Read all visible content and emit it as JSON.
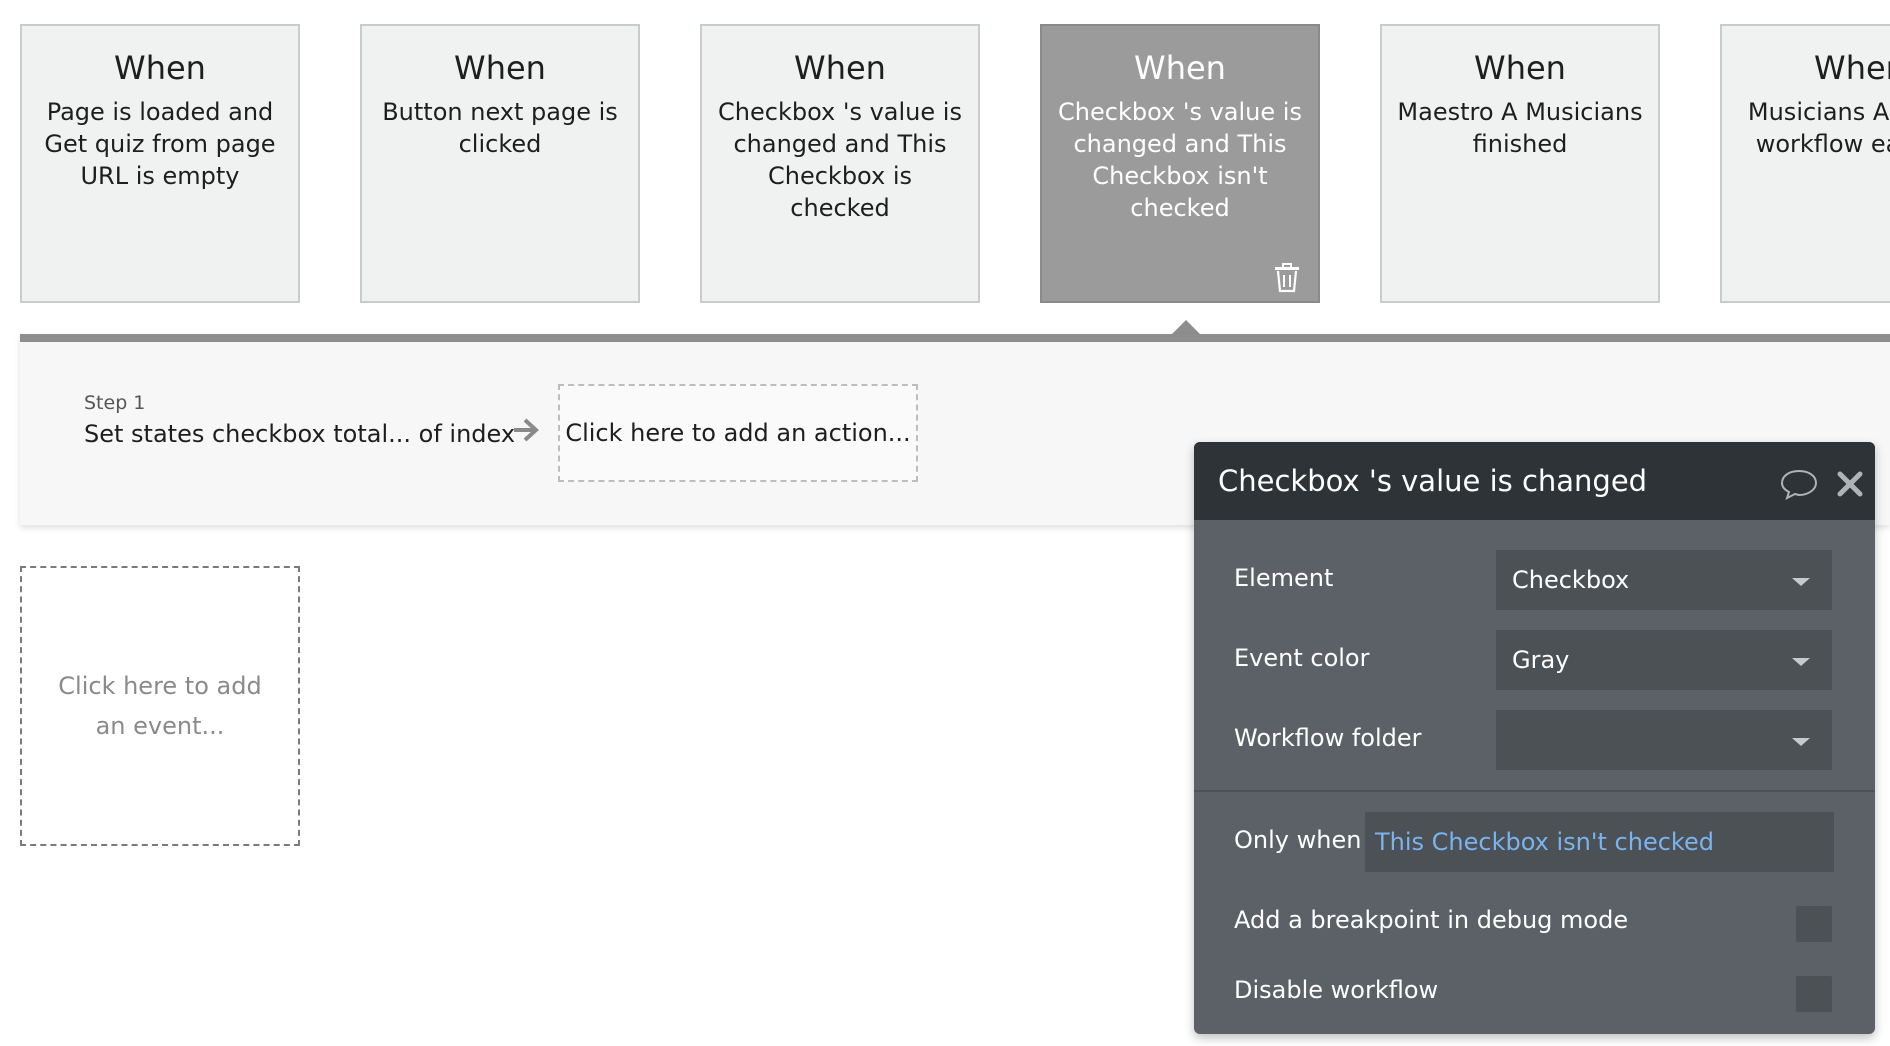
{
  "events": [
    {
      "when": "When",
      "description": "Page is loaded and Get quiz from page URL is empty",
      "selected": false
    },
    {
      "when": "When",
      "description": "Button next page is clicked",
      "selected": false
    },
    {
      "when": "When",
      "description": "Checkbox 's value is changed and This Checkbox is checked",
      "selected": false
    },
    {
      "when": "When",
      "description": "Checkbox 's value is changed and This Checkbox isn't checked",
      "selected": true
    },
    {
      "when": "When",
      "description": "Maestro A Musicians finished",
      "selected": false
    },
    {
      "when": "When",
      "description": "Musicians A W this workflow each ce",
      "selected": false
    }
  ],
  "actions": {
    "step_label": "Step 1",
    "step_name": "Set states checkbox total... of index",
    "add_action": "Click here to add an action..."
  },
  "add_event": "Click here to add an event...",
  "panel": {
    "title": "Checkbox 's value is changed",
    "element_label": "Element",
    "element_value": "Checkbox",
    "event_color_label": "Event color",
    "event_color_value": "Gray",
    "workflow_folder_label": "Workflow folder",
    "workflow_folder_value": "",
    "only_when_label": "Only when",
    "only_when_value": "This Checkbox isn't checked",
    "breakpoint_label": "Add a breakpoint in debug mode",
    "disable_label": "Disable workflow"
  },
  "colors": {
    "card_bg": "#f0f2f1",
    "card_selected_bg": "#9b9b9b",
    "panel_bg": "#5b6166",
    "panel_header_bg": "#2d3336",
    "condition_text": "#7ab3ee"
  },
  "icons": [
    "trash-icon",
    "arrow-right-icon",
    "comment-icon",
    "close-icon",
    "chevron-down-icon"
  ]
}
